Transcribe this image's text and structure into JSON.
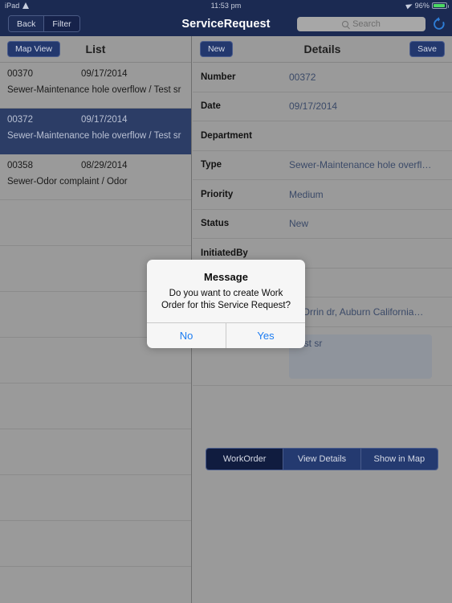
{
  "statusbar": {
    "device": "iPad",
    "wifi_icon": "wifi-icon",
    "time": "11:53 pm",
    "location_icon": "location-arrow-icon",
    "battery_percent": "96%",
    "battery_icon": "battery-icon"
  },
  "navbar": {
    "segments": [
      {
        "label": "Back",
        "selected": false
      },
      {
        "label": "Filter",
        "selected": true
      }
    ],
    "title": "ServiceRequest",
    "search": {
      "placeholder": "Search",
      "value": "",
      "icon": "search-icon"
    },
    "refresh_icon": "refresh-icon"
  },
  "left_pane": {
    "toolbar": {
      "map_view_label": "Map View",
      "title": "List"
    },
    "rows": [
      {
        "number": "00370",
        "date": "09/17/2014",
        "subtitle": "Sewer-Maintenance hole overflow / Test sr",
        "selected": false
      },
      {
        "number": "00372",
        "date": "09/17/2014",
        "subtitle": "Sewer-Maintenance hole overflow / Test sr",
        "selected": true
      },
      {
        "number": "00358",
        "date": "08/29/2014",
        "subtitle": "Sewer-Odor complaint / Odor",
        "selected": false
      }
    ],
    "empty_row_count": 8
  },
  "right_pane": {
    "toolbar": {
      "new_label": "New",
      "title": "Details",
      "save_label": "Save"
    },
    "fields": [
      {
        "label": "Number",
        "value": "00372",
        "type": "text"
      },
      {
        "label": "Date",
        "value": "09/17/2014",
        "type": "text"
      },
      {
        "label": "Department",
        "value": "",
        "type": "text"
      },
      {
        "label": "Type",
        "value": "Sewer-Maintenance hole overfl…",
        "type": "text"
      },
      {
        "label": "Priority",
        "value": "Medium",
        "type": "text"
      },
      {
        "label": "Status",
        "value": "New",
        "type": "text"
      },
      {
        "label": "InitiatedBy",
        "value": "",
        "type": "text"
      },
      {
        "label": "",
        "value": "",
        "type": "text"
      },
      {
        "label": "",
        "value": "90 Orrin dr, Auburn California…",
        "type": "text"
      },
      {
        "label": "Description",
        "value": "Test sr",
        "type": "textarea"
      }
    ],
    "actions": [
      {
        "label": "WorkOrder",
        "selected": true
      },
      {
        "label": "View Details",
        "selected": false
      },
      {
        "label": "Show in Map",
        "selected": false
      }
    ]
  },
  "alert": {
    "title": "Message",
    "message": "Do you want to create Work Order for this Service Request?",
    "buttons": [
      {
        "label": "No"
      },
      {
        "label": "Yes"
      }
    ]
  },
  "colors": {
    "navy": "#1b2a52",
    "button_navy": "#23386e",
    "selected_row": "#2c3d66",
    "pane_gray": "#9a9a9a",
    "value_blue": "#3b4a68",
    "link_blue": "#1c7cf2",
    "battery_green": "#4cd964"
  }
}
